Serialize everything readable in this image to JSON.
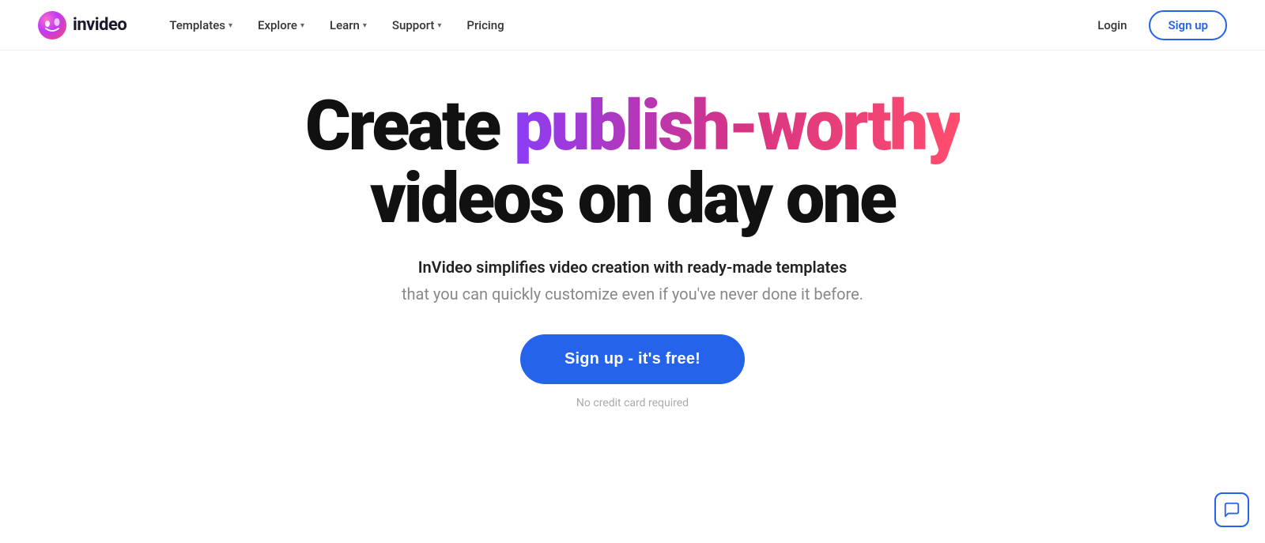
{
  "brand": {
    "name": "invideo",
    "logo_alt": "InVideo logo"
  },
  "nav": {
    "items": [
      {
        "label": "Templates",
        "has_dropdown": true
      },
      {
        "label": "Explore",
        "has_dropdown": true
      },
      {
        "label": "Learn",
        "has_dropdown": true
      },
      {
        "label": "Support",
        "has_dropdown": true
      },
      {
        "label": "Pricing",
        "has_dropdown": false
      }
    ],
    "login_label": "Login",
    "signup_label": "Sign up"
  },
  "hero": {
    "headline_prefix": "Create ",
    "headline_gradient": "publish-worthy",
    "headline_suffix": "videos on day one",
    "subtitle_line1": "InVideo simplifies video creation with ready-made templates",
    "subtitle_line2": "that you can quickly customize even if you've never done it before.",
    "cta_label": "Sign up - it's free!",
    "no_credit_label": "No credit card required"
  }
}
